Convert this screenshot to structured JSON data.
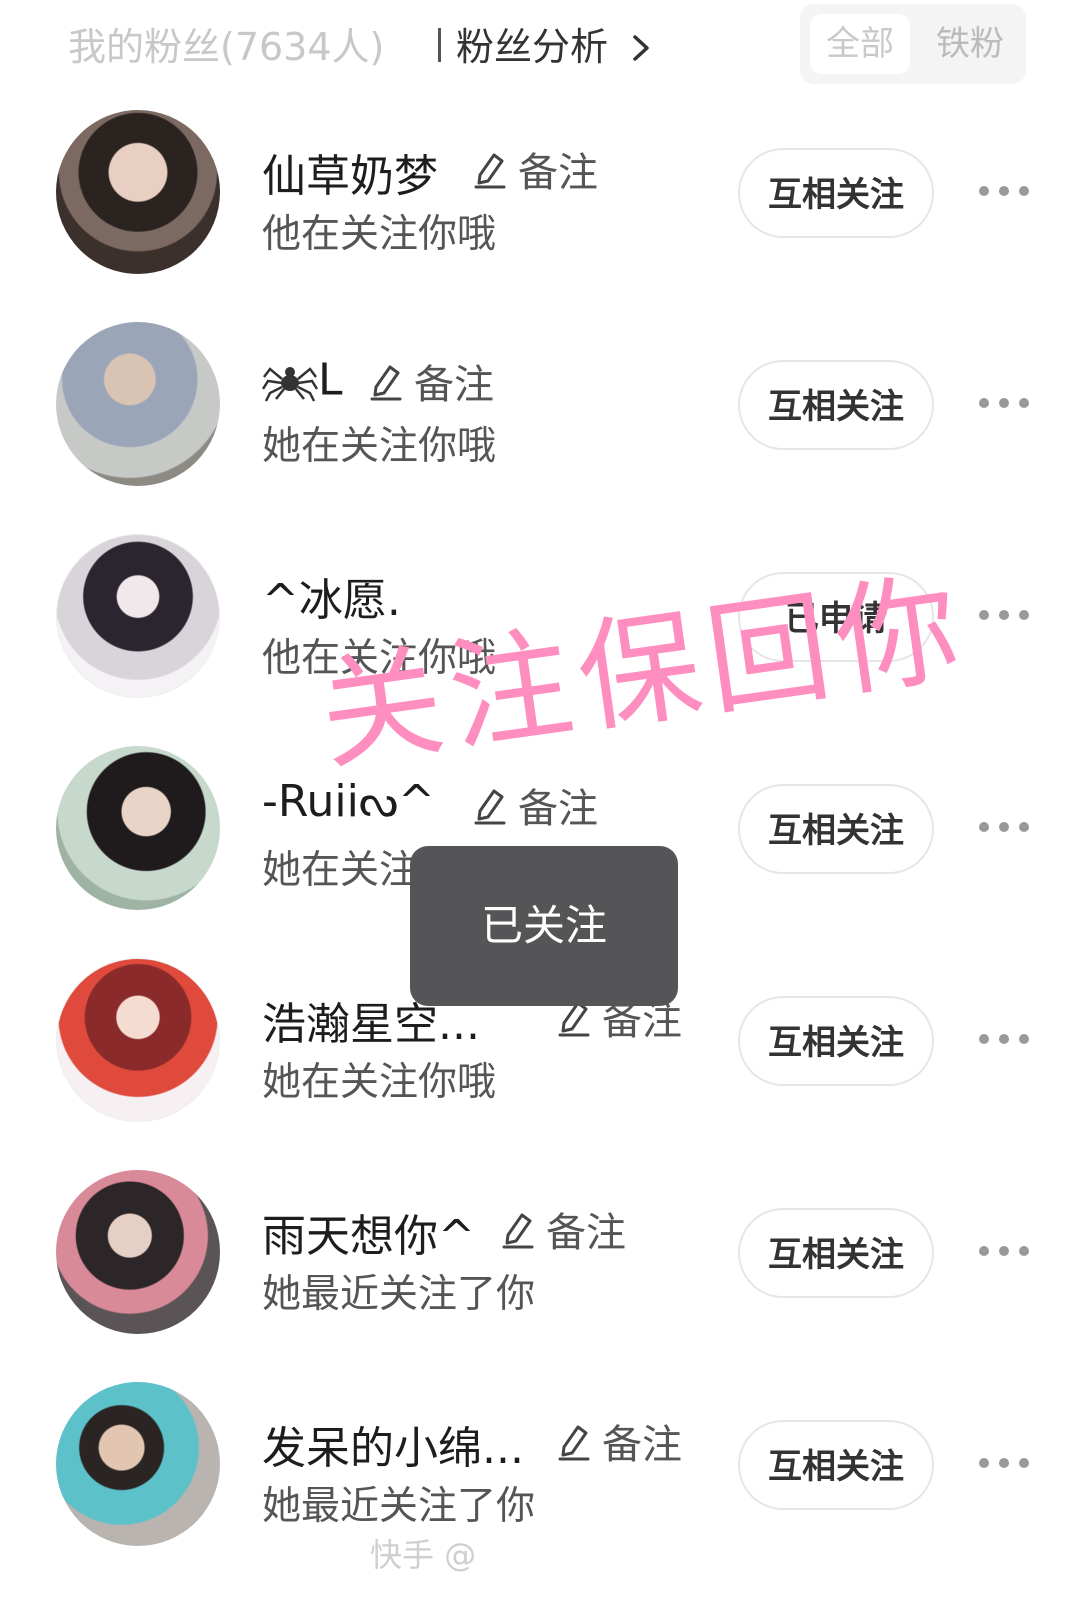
{
  "header": {
    "title": "我的粉丝(7634人)",
    "analysis_label": "粉丝分析",
    "tabs": [
      {
        "label": "全部"
      },
      {
        "label": "铁粉"
      }
    ]
  },
  "remark_label": "备注",
  "fans": [
    {
      "name": "仙草奶梦",
      "subtitle": "他在关注你哦",
      "has_remark": true,
      "button": "互相关注"
    },
    {
      "name": "L",
      "name_prefix_icon": "spider-icon",
      "subtitle": "她在关注你哦",
      "has_remark": true,
      "button": "互相关注"
    },
    {
      "name": "^冰愿.",
      "subtitle": "他在关注你哦",
      "has_remark": false,
      "button": "已申请"
    },
    {
      "name": "-Ruii",
      "name_suffix": "ᔓ^",
      "subtitle": "她在关注你哦",
      "has_remark": true,
      "button": "互相关注"
    },
    {
      "name": "浩瀚星空...",
      "subtitle": "她在关注你哦",
      "has_remark": true,
      "button": "互相关注"
    },
    {
      "name": "雨天想你^",
      "subtitle": "她最近关注了你",
      "has_remark": true,
      "button": "互相关注"
    },
    {
      "name": "发呆的小绵...",
      "subtitle": "她最近关注了你",
      "has_remark": true,
      "button": "互相关注"
    }
  ],
  "toast": "已关注",
  "overlay_text": "关注保回你",
  "watermark": "快手 @",
  "colors": {
    "overlay_pink": "#ff8ec0",
    "toast_bg": "#555557",
    "button_border": "#e6e6e6"
  }
}
